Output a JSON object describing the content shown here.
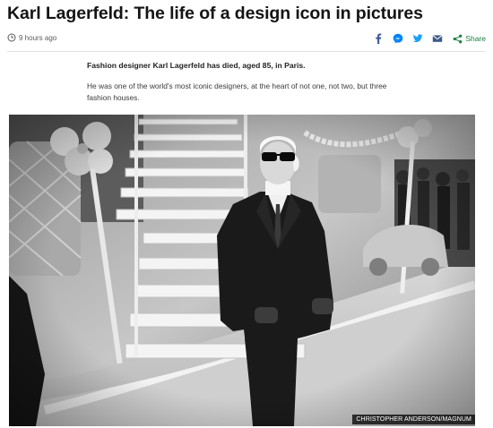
{
  "article": {
    "headline": "Karl Lagerfeld: The life of a design icon in pictures",
    "timestamp": "9 hours ago",
    "summary": "Fashion designer Karl Lagerfeld has died, aged 85, in Paris.",
    "intro": "He was one of the world's most iconic designers, at the heart of not one, not two, but three fashion houses."
  },
  "share": {
    "label": "Share",
    "icons": [
      "facebook-icon",
      "messenger-icon",
      "twitter-icon",
      "email-icon",
      "share-icon"
    ],
    "colors": {
      "facebook": "#3b5998",
      "messenger": "#0084ff",
      "twitter": "#1da1f2",
      "email": "#3a5b87",
      "share": "#1d7e3e"
    }
  },
  "image": {
    "credit": "CHRISTOPHER ANDERSON/MAGNUM",
    "style": "black-and-white photograph"
  }
}
